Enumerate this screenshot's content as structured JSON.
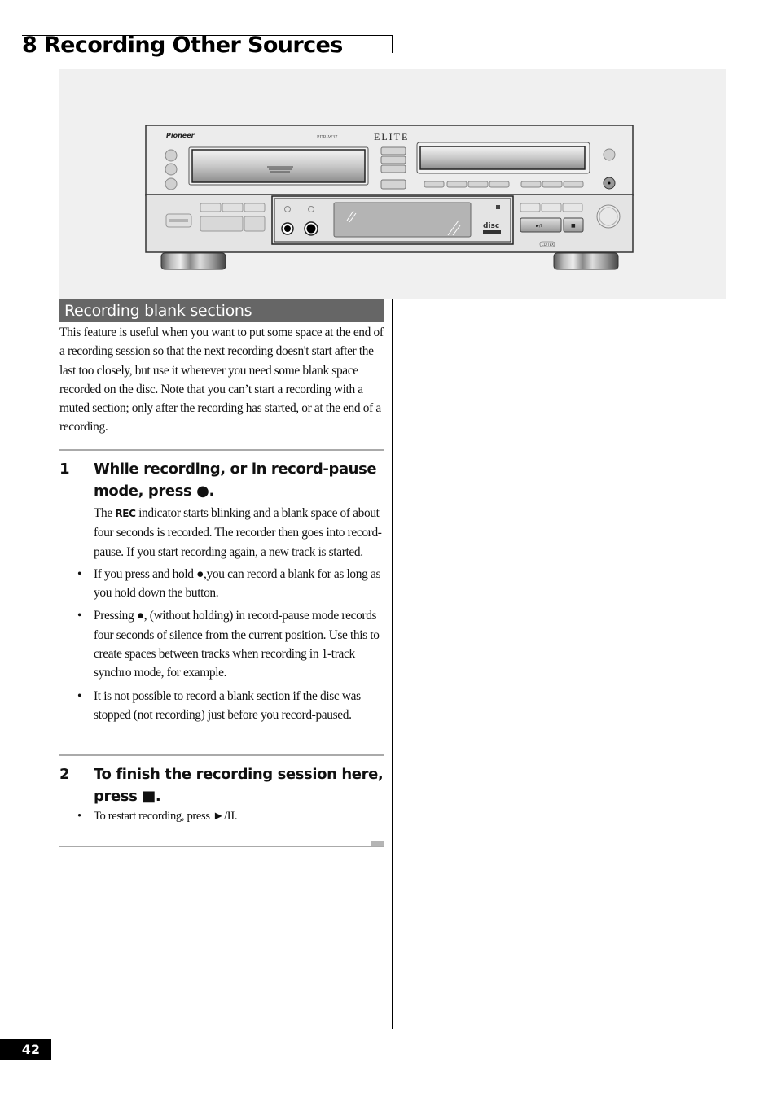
{
  "chapter": {
    "title": "8 Recording Other Sources"
  },
  "illustration": {
    "brand": "Pioneer",
    "model": "PDR-W37",
    "series": "ELITE",
    "disc_logo": "disc",
    "cd_text_logo": "CD TEXT",
    "play_pause_symbol": "►/II",
    "stop_symbol": "■",
    "colors": {
      "background": "#f0f0f0",
      "body": "#e8e8e8",
      "outline": "#333333"
    }
  },
  "section": {
    "title": "Recording blank sections",
    "bar_color": "#666666",
    "intro": "This feature is useful when you want to put some space at the end of a recording session so that the next recording doesn't start after the last too closely, but use it wherever you need some blank space recorded on the disc. Note that you can’t start a recording with a muted section; only after the recording has started, or at the end of a recording."
  },
  "steps": [
    {
      "number": "1",
      "title": "While recording, or in record-pause mode, press ●.",
      "body_prefix": "The ",
      "body_label": "REC",
      "body_suffix": " indicator starts blinking and a blank space of about four seconds is recorded. The recorder then goes into record-pause. If you start recording again, a new track is started.",
      "bullets": [
        "If you press and hold ●,you can record a blank for as long as you hold down the button.",
        "Pressing ●, (without holding) in record-pause mode records four seconds of silence from the current position. Use this to create spaces between tracks when recording in 1-track synchro mode, for example.",
        "It is not possible to record a blank section if the disc was stopped (not recording) just before you record-paused."
      ]
    },
    {
      "number": "2",
      "title": "To finish the recording session here, press ■.",
      "bullets": [
        "To restart recording, press ►/II."
      ]
    }
  ],
  "bullet_glyph": "•",
  "page": {
    "number": "42"
  }
}
